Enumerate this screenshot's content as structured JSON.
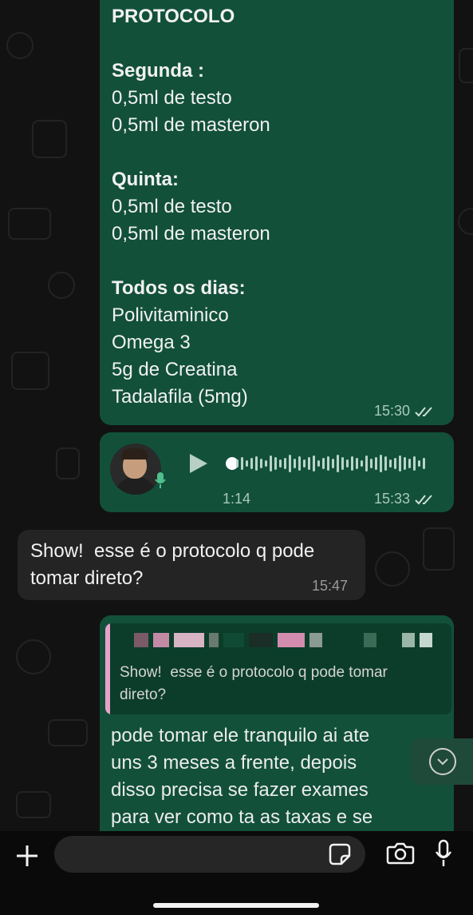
{
  "colors": {
    "outgoing_bubble": "#12503a",
    "incoming_bubble": "#242424",
    "quote_accent": "#e8a2c8"
  },
  "messages": {
    "protocol": {
      "title": "PROTOCOLO",
      "monday_label": "Segunda :",
      "monday_item1": "0,5ml de testo",
      "monday_item2": "0,5ml de masteron",
      "thursday_label": "Quinta:",
      "thursday_item1": "0,5ml de testo",
      "thursday_item2": "0,5ml de masteron",
      "daily_label": "Todos os dias:",
      "daily_item1": "Polivitaminico",
      "daily_item2": "Omega 3",
      "daily_item3": "5g de Creatina",
      "daily_item4": "Tadalafila (5mg)",
      "time": "15:30",
      "status_icon": "double-check-icon"
    },
    "voice": {
      "duration": "1:14",
      "time": "15:33",
      "status_icon": "double-check-icon",
      "progress": 0
    },
    "incoming": {
      "line1": "Show!  esse é o protocolo q pode",
      "line2": "tomar direto?",
      "time": "15:47"
    },
    "reply": {
      "quoted_line1": "Show!  esse é o protocolo q pode tomar",
      "quoted_line2": "direto?",
      "line1": "pode tomar ele tranquilo ai ate",
      "line2": "uns 3 meses a frente, depois",
      "line3": "disso precisa se fazer exames",
      "line4": "para ver como ta as taxas e se"
    }
  },
  "input": {
    "placeholder": ""
  }
}
